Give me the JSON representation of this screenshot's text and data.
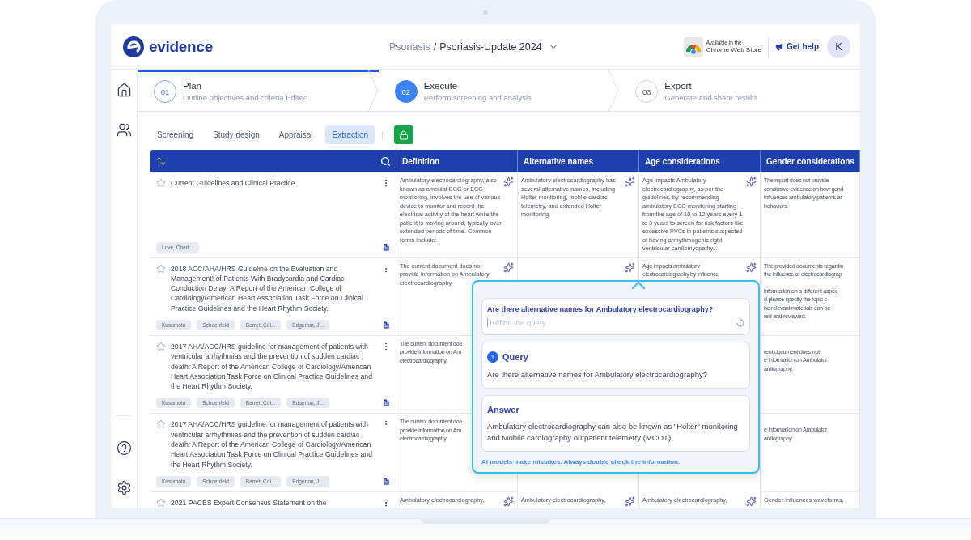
{
  "header": {
    "logo": "evidence",
    "breadcrumb_parent": "Psoriasis",
    "breadcrumb_separator": "/",
    "breadcrumb_current": "Psoriasis-Update 2024",
    "store_line1": "Available in the",
    "store_line2": "Chrome Web Store",
    "help": "Get help",
    "avatar": "K"
  },
  "steps": [
    {
      "number": "01",
      "title": "Plan",
      "subtitle": "Outline objectives and criteria Edited",
      "completed": true,
      "selected": false
    },
    {
      "number": "02",
      "title": "Execute",
      "subtitle": "Perform screening and analysis",
      "completed": false,
      "selected": true
    },
    {
      "number": "03",
      "title": "Export",
      "subtitle": "Generate and share results",
      "completed": false,
      "selected": false
    }
  ],
  "subtabs": [
    {
      "label": "Screening",
      "selected": false
    },
    {
      "label": "Study design",
      "selected": false
    },
    {
      "label": "Appraisal",
      "selected": false
    },
    {
      "label": "Extraction",
      "selected": true
    }
  ],
  "lock": {
    "locked": false
  },
  "table": {
    "columns": [
      "Definition",
      "Alternative names",
      "Age considerations",
      "Gender considerations"
    ],
    "rows": [
      {
        "title": "Current Guidelines and Clinical Practice.",
        "starred": false,
        "authors": [
          "Love, Charl..."
        ],
        "cells": [
          {
            "text": "Ambulatory electrocardiography, also known as ambulat ECG or ECG monitoring, involves the use of various device to monitor and record the electrical activity of the heart while the patient is moving around, typically over extended periods of time. Common forms include:",
            "ai": true
          },
          {
            "text": "Ambulatory electrocardiography has several alternative names, including Holter monitoring, mobile cardiac telemetry, and extended Holter monitoring.",
            "ai": true
          },
          {
            "text": "Age impacts Ambulatory electrocardiography, as per the guidelines, by recommending ambulatory ECG monitoring starting from the age of 10 to 12 years every 1 to 3 years to screen for risk factors like excessive PVCs in patients suspected of having arrhythmogenic right ventricular cardiomyopathy...",
            "ai": true
          },
          {
            "lines": [
              "The report does not provide",
              "conclusive evidence on how gend",
              "influences ambulatory patterns ar",
              "behaviors."
            ]
          }
        ]
      },
      {
        "title": "2018 ACC/AHA/HRS Guideline on the Evaluation and Management! of Patients With Bradycardia and Cardiac Conduction Delay: A Report of the American College of Cardiology/American Heart Association Task Force on Clinical Practice Guidelines and the Heart Rhythm Society.",
        "starred": false,
        "authors": [
          "Kusumoto",
          "Schoenfeld",
          "Barrett,Col...",
          "Edgerton, J..."
        ],
        "cells": [
          {
            "text": "The current document does not provide information on Ambulatory electrocardiography.",
            "ai": true
          },
          {
            "ai": true
          },
          {
            "lines": [
              "Age impacts ambulatory",
              "electrocardiography by influence"
            ],
            "ai": true
          },
          {
            "lines": [
              "The provided documents regardin",
              "the influence of electrocardiograp"
            ],
            "lines_beside_popup": [
              "information on a different aspec",
              "d please specify the topic s",
              "he relevant materials can be",
              "red and reviewed."
            ]
          }
        ]
      },
      {
        "title": "2017 AHA/ACC/HRS guideline for management of patients with ventricular arrhythmias and the prevention of sudden cardiac death: A Report of the American College of Cardiology/American Heart Association Task Force on Clinical Practice Guidelines and the Heart Rhythm Society.",
        "starred": false,
        "authors": [
          "Kusumoto",
          "Schoenfeld",
          "Barrett,Col...",
          "Edgerton, J..."
        ],
        "cells": [
          {
            "lines": [
              "The current document doe",
              "provide information on Am",
              "electrocardiography."
            ]
          },
          {},
          {},
          {
            "lines_beside_popup": [
              "rent document does not",
              "e information on Ambulator",
              "ardiography."
            ]
          }
        ]
      },
      {
        "title": "2017 AHA/ACC/HRS guideline for management of patients with ventricular arrhythmias and the prevention of sudden cardiac death: A Report of the American College of Cardiology/American Heart Association Task Force on Clinical Practice Guidelines and the Heart Rhythm Society.",
        "starred": false,
        "authors": [
          "Kusumoto",
          "Schoenfeld",
          "Barrett,Col...",
          "Edgerton, J..."
        ],
        "cells": [
          {
            "lines": [
              "The current document doe",
              "provide information on Am",
              "electrocardiography."
            ]
          },
          {},
          {},
          {
            "lines_beside_popup": [
              "e information on Ambulator",
              "ardiography."
            ]
          }
        ]
      },
      {
        "title": "2021 PACES Expert Consensus Statement on the",
        "starred": false,
        "authors": [],
        "cells": [
          {
            "text": "Ambulatory electrocardiography,",
            "ai": true
          },
          {
            "text": "Ambulatory electrocardiography,",
            "ai": true
          },
          {
            "text": "Ambulatory electrocardiography,",
            "ai": true
          },
          {
            "text": "Gender influences waveforms,"
          }
        ]
      }
    ]
  },
  "popup": {
    "question": "Are there alternative names for Ambulatory electrocardiography?",
    "placeholder": "Refine the query",
    "loading": true,
    "query": {
      "number": "1",
      "title": "Query",
      "text": "Are there alternative names for Ambulatory electrocardiography?"
    },
    "answer": {
      "title": "Answer",
      "text": "Ambulatory electrocardiography can also be known as \"Holter\" monitoring and Mobile cardiography outpatient telemetry (MCOT)"
    },
    "disclaimer": "AI models make mistakes. Always double check the information."
  }
}
